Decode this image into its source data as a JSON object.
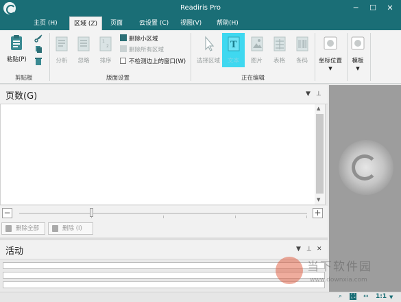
{
  "window": {
    "title": "Readiris Pro",
    "controls": [
      "─",
      "☐",
      "✕"
    ]
  },
  "menu": {
    "items": [
      {
        "label": "主页 (H)"
      },
      {
        "label": "区域 (Z)",
        "active": true
      },
      {
        "label": "页面"
      },
      {
        "label": "云设置 (C)"
      },
      {
        "label": "视图(V)"
      },
      {
        "label": "帮助(H)"
      }
    ]
  },
  "ribbon": {
    "clipboard": {
      "paste_label": "粘贴(P)",
      "group_label": "剪贴板"
    },
    "page_settings": {
      "analyze_label": "分析",
      "ignore_label": "忽略",
      "sort_label": "排序",
      "delete_small_label": "删除小区域",
      "delete_all_label": "删除所有区域",
      "no_border_label": "不检测边上的窗口(W)",
      "group_label": "版面设置"
    },
    "editing": {
      "select_label": "选择区域",
      "text_label": "文本",
      "image_label": "图片",
      "table_label": "表格",
      "barcode_label": "条码",
      "group_label": "正在编辑"
    },
    "coords_label": "坐标位置",
    "template_label": "模板"
  },
  "pages_panel": {
    "title": "页数(G)",
    "zoom_level": 0.25,
    "delete_all_label": "删除全部",
    "delete_label": "删除 (I)"
  },
  "activity_panel": {
    "title": "活动"
  },
  "statusbar": {
    "zoom_label": "1:1"
  },
  "watermark": {
    "text": "当下软件园",
    "url": "www.downxia.com"
  },
  "colors": {
    "accent": "#1a6e76",
    "highlight": "#3fd8f0"
  }
}
